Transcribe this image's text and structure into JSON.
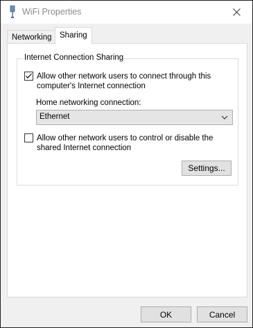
{
  "window": {
    "title": "WiFi Properties",
    "title_icon": "wifi-adapter-icon",
    "close_icon": "close-icon"
  },
  "tabs": [
    {
      "label": "Networking",
      "active": false
    },
    {
      "label": "Sharing",
      "active": true
    }
  ],
  "group": {
    "label": "Internet Connection Sharing",
    "allow_connect": {
      "checked": true,
      "line1": "Allow other network users to connect through this",
      "line2": "computer's Internet connection"
    },
    "home_connection": {
      "label": "Home networking connection:",
      "value": "Ethernet"
    },
    "allow_control": {
      "checked": false,
      "line1": "Allow other network users to control or disable the",
      "line2": "shared Internet connection"
    },
    "settings_label": "Settings..."
  },
  "footer": {
    "ok_label": "OK",
    "cancel_label": "Cancel"
  },
  "colors": {
    "window_background": "#f0f0f0",
    "panel_background": "#ffffff",
    "button_face": "#e1e1e1"
  }
}
